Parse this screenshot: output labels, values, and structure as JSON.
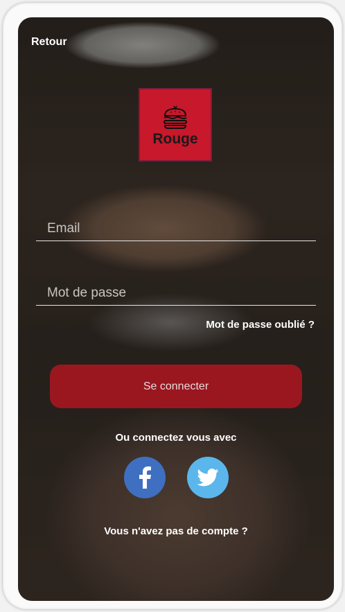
{
  "nav": {
    "back_label": "Retour"
  },
  "logo": {
    "text": "Rouge",
    "icon": "burger-icon",
    "color": "#c8182b"
  },
  "form": {
    "email_placeholder": "Email",
    "email_value": "",
    "password_placeholder": "Mot de passe",
    "password_value": "",
    "forgot_label": "Mot de passe oublié ?",
    "submit_label": "Se connecter",
    "submit_color": "#c81423"
  },
  "social": {
    "label": "Ou connectez vous avec",
    "facebook": {
      "icon": "facebook-icon",
      "color": "#3f6fc1"
    },
    "twitter": {
      "icon": "twitter-icon",
      "color": "#5bb6ec"
    }
  },
  "signup": {
    "label": "Vous n'avez pas de compte ?"
  }
}
